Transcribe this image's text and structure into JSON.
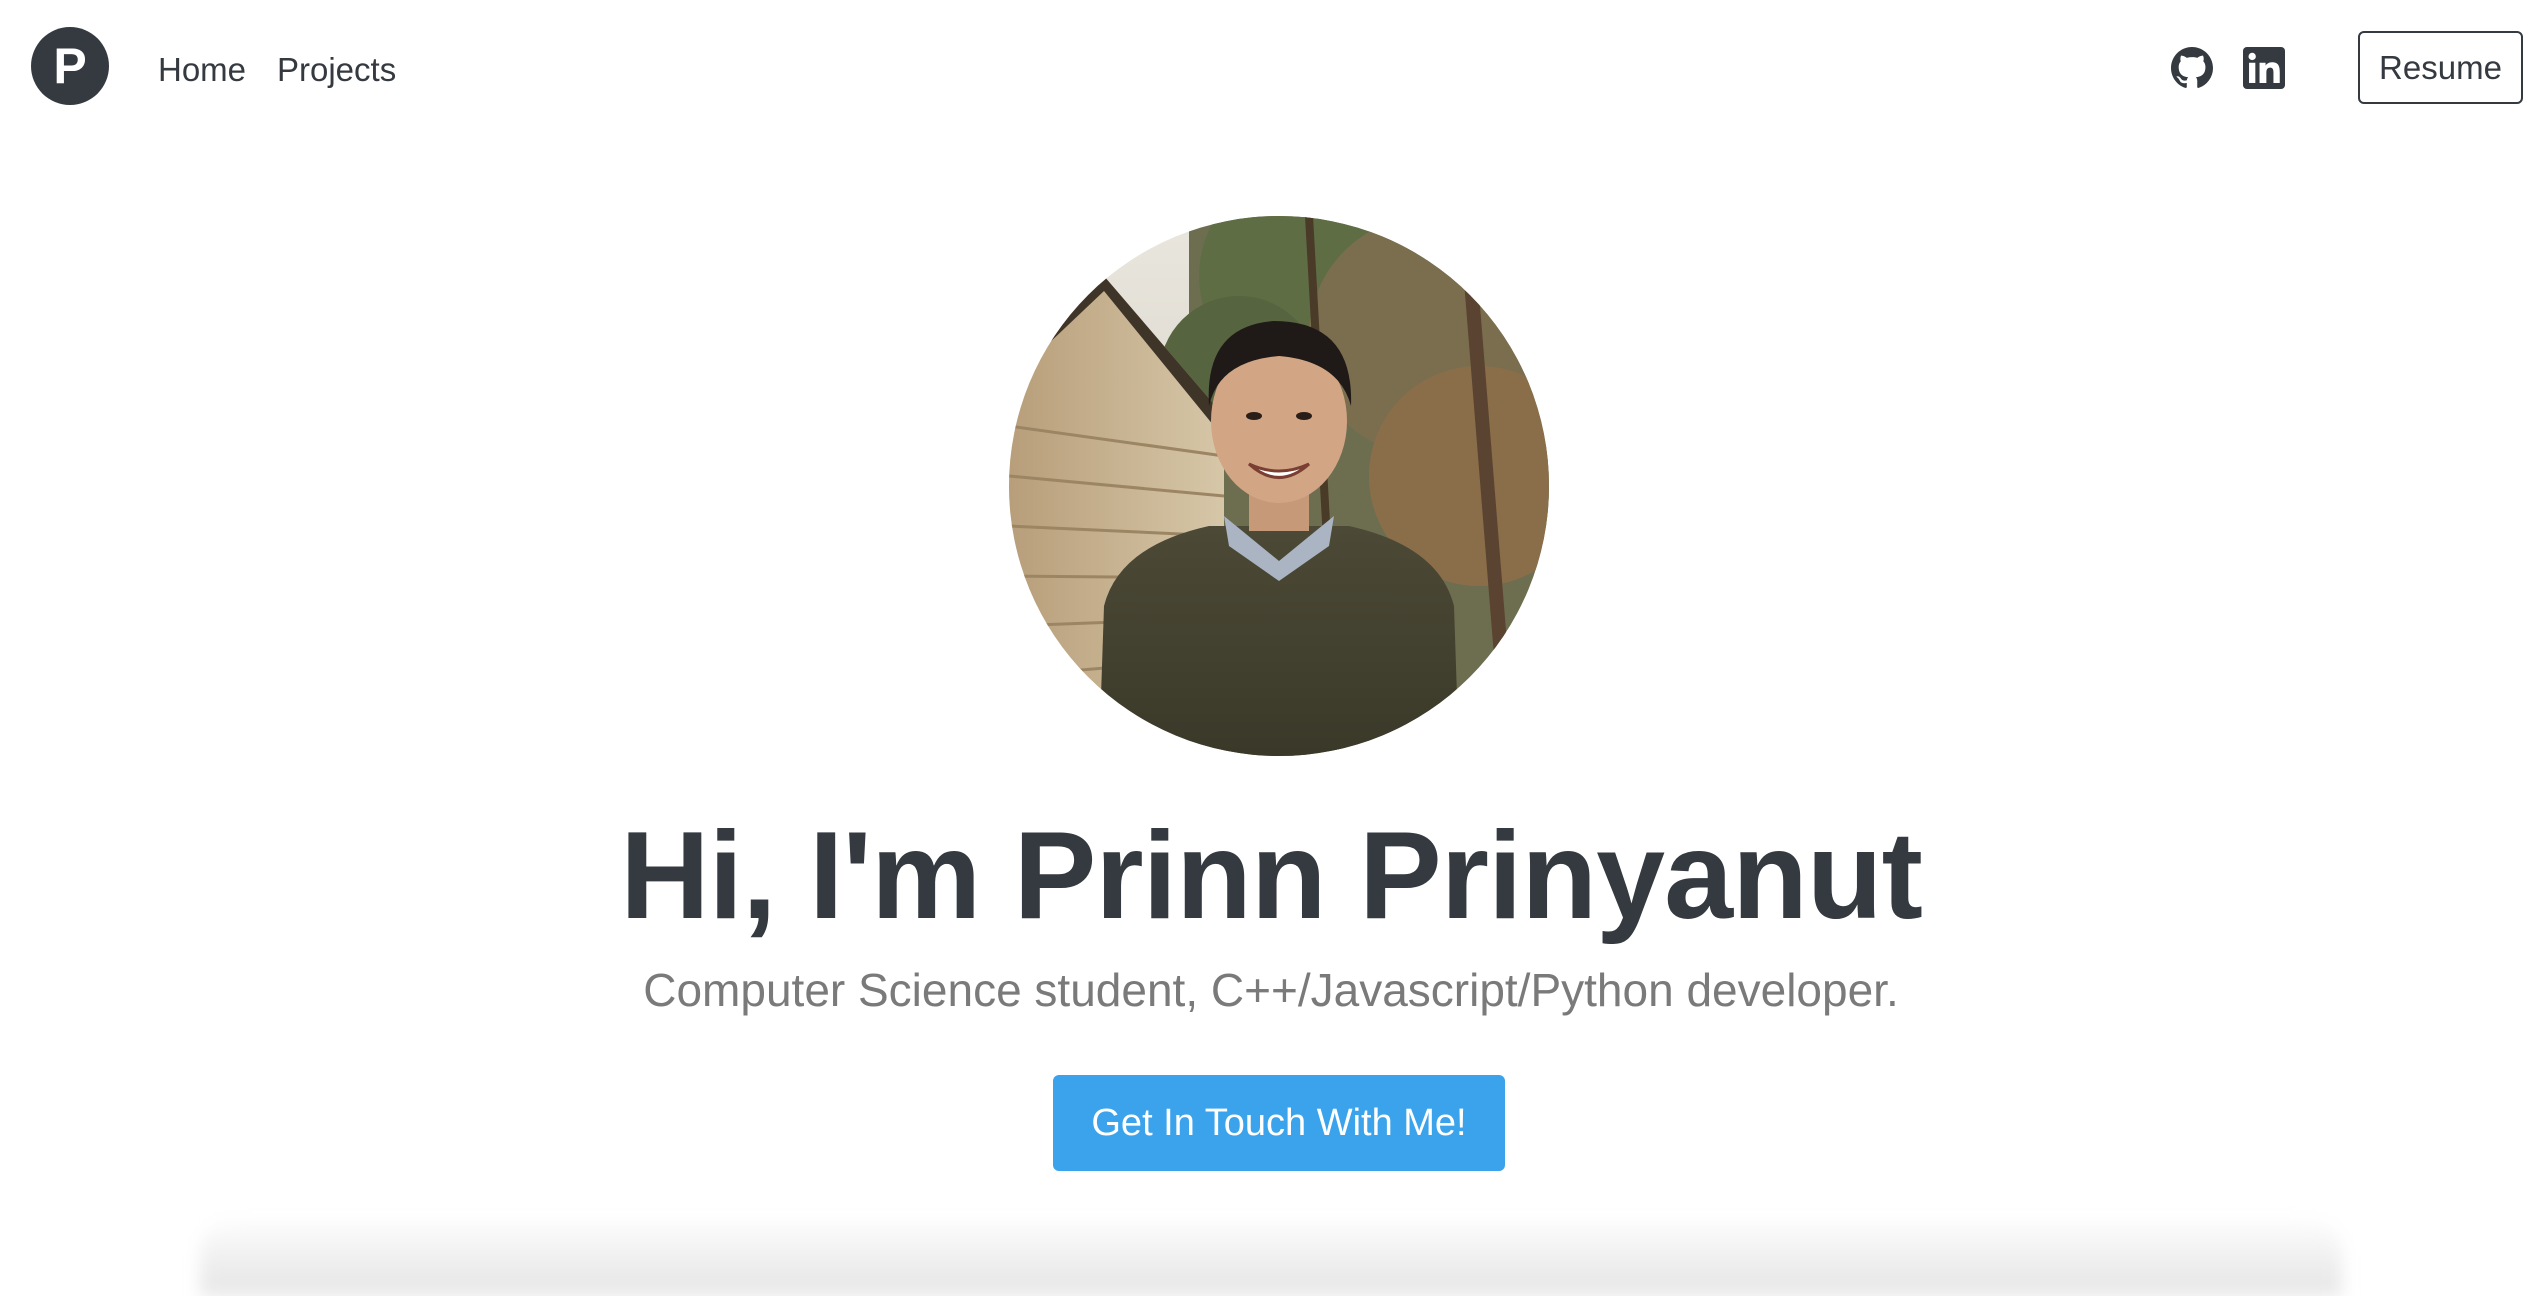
{
  "nav": {
    "logo_letter": "P",
    "links": [
      {
        "label": "Home"
      },
      {
        "label": "Projects"
      }
    ],
    "social": [
      {
        "icon": "github-icon"
      },
      {
        "icon": "linkedin-icon"
      }
    ],
    "resume_label": "Resume"
  },
  "hero": {
    "title": "Hi, I'm Prinn Prinyanut",
    "subtitle": "Computer Science student, C++/Javascript/Python developer.",
    "cta_label": "Get In Touch With Me!"
  },
  "colors": {
    "text_dark": "#343a40",
    "subtitle_gray": "#7a7a7a",
    "cta_blue": "#3ba3eb",
    "background": "#ffffff"
  }
}
